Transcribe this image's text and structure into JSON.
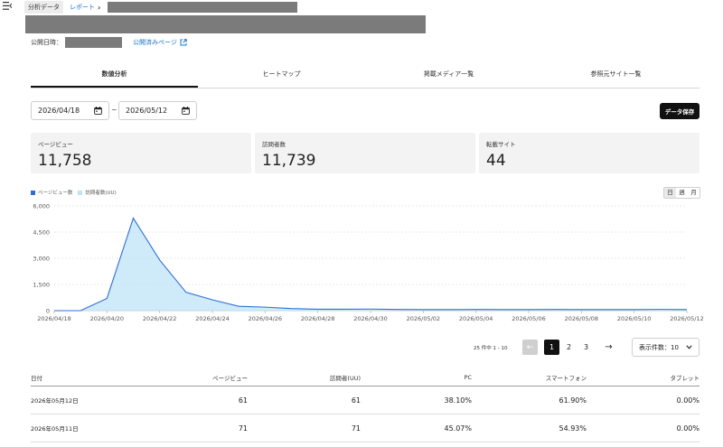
{
  "breadcrumb": {
    "root": "分析データ",
    "current": "レポート"
  },
  "meta": {
    "published_label": "公開日時：",
    "published_page_link": "公開済みページ"
  },
  "tabs": [
    {
      "label": "数値分析",
      "active": true
    },
    {
      "label": "ヒートマップ",
      "active": false
    },
    {
      "label": "掲載メディア一覧",
      "active": false
    },
    {
      "label": "参照元サイト一覧",
      "active": false
    }
  ],
  "date_range": {
    "start": "2026/04/18",
    "separator": "~",
    "end": "2026/05/12"
  },
  "save_button": "データ保存",
  "stats": [
    {
      "label": "ページビュー",
      "value": "11,758"
    },
    {
      "label": "訪問者数",
      "value": "11,739"
    },
    {
      "label": "転載サイト",
      "value": "44"
    }
  ],
  "period_toggle": {
    "options": [
      "日",
      "週",
      "月"
    ],
    "selected": "日"
  },
  "chart_data": {
    "type": "area",
    "legend": [
      "ページビュー数",
      "訪問者数(UU)"
    ],
    "legend_colors": [
      "#2f6fd4",
      "#bfe3f7"
    ],
    "ylim": [
      0,
      6000
    ],
    "yticks": [
      "6,000",
      "4,500",
      "3,000",
      "1,500",
      "0"
    ],
    "ytick_values": [
      6000,
      4500,
      3000,
      1500,
      0
    ],
    "xticks": [
      "2026/04/18",
      "2026/04/20",
      "2026/04/22",
      "2026/04/24",
      "2026/04/26",
      "2026/04/28",
      "2026/04/30",
      "2026/05/02",
      "2026/05/04",
      "2026/05/06",
      "2026/05/08",
      "2026/05/10",
      "2026/05/12"
    ],
    "x": [
      "2026/04/18",
      "2026/04/19",
      "2026/04/20",
      "2026/04/21",
      "2026/04/22",
      "2026/04/23",
      "2026/04/24",
      "2026/04/25",
      "2026/04/26",
      "2026/04/27",
      "2026/04/28",
      "2026/04/29",
      "2026/04/30",
      "2026/05/01",
      "2026/05/02",
      "2026/05/03",
      "2026/05/04",
      "2026/05/05",
      "2026/05/06",
      "2026/05/07",
      "2026/05/08",
      "2026/05/09",
      "2026/05/10",
      "2026/05/11",
      "2026/05/12"
    ],
    "series": [
      {
        "name": "ページビュー数",
        "values": [
          0,
          0,
          700,
          5300,
          2900,
          1050,
          620,
          250,
          200,
          120,
          80,
          80,
          90,
          70,
          60,
          60,
          70,
          60,
          60,
          70,
          60,
          60,
          60,
          71,
          61
        ]
      },
      {
        "name": "訪問者数(UU)",
        "values": [
          0,
          0,
          690,
          5290,
          2890,
          1045,
          615,
          248,
          198,
          118,
          79,
          79,
          89,
          69,
          59,
          59,
          69,
          59,
          59,
          69,
          59,
          59,
          59,
          71,
          61
        ]
      }
    ]
  },
  "pagination": {
    "range_text": "25 件中 1 - 10",
    "pages": [
      "1",
      "2",
      "3"
    ],
    "current": "1",
    "per_page": "表示件数：10"
  },
  "table": {
    "headers": [
      "日付",
      "ページビュー",
      "訪問者(UU)",
      "PC",
      "スマートフォン",
      "タブレット"
    ],
    "rows": [
      [
        "2026年05月12日",
        "61",
        "61",
        "38.10%",
        "61.90%",
        "0.00%"
      ],
      [
        "2026年05月11日",
        "71",
        "71",
        "45.07%",
        "54.93%",
        "0.00%"
      ]
    ]
  }
}
